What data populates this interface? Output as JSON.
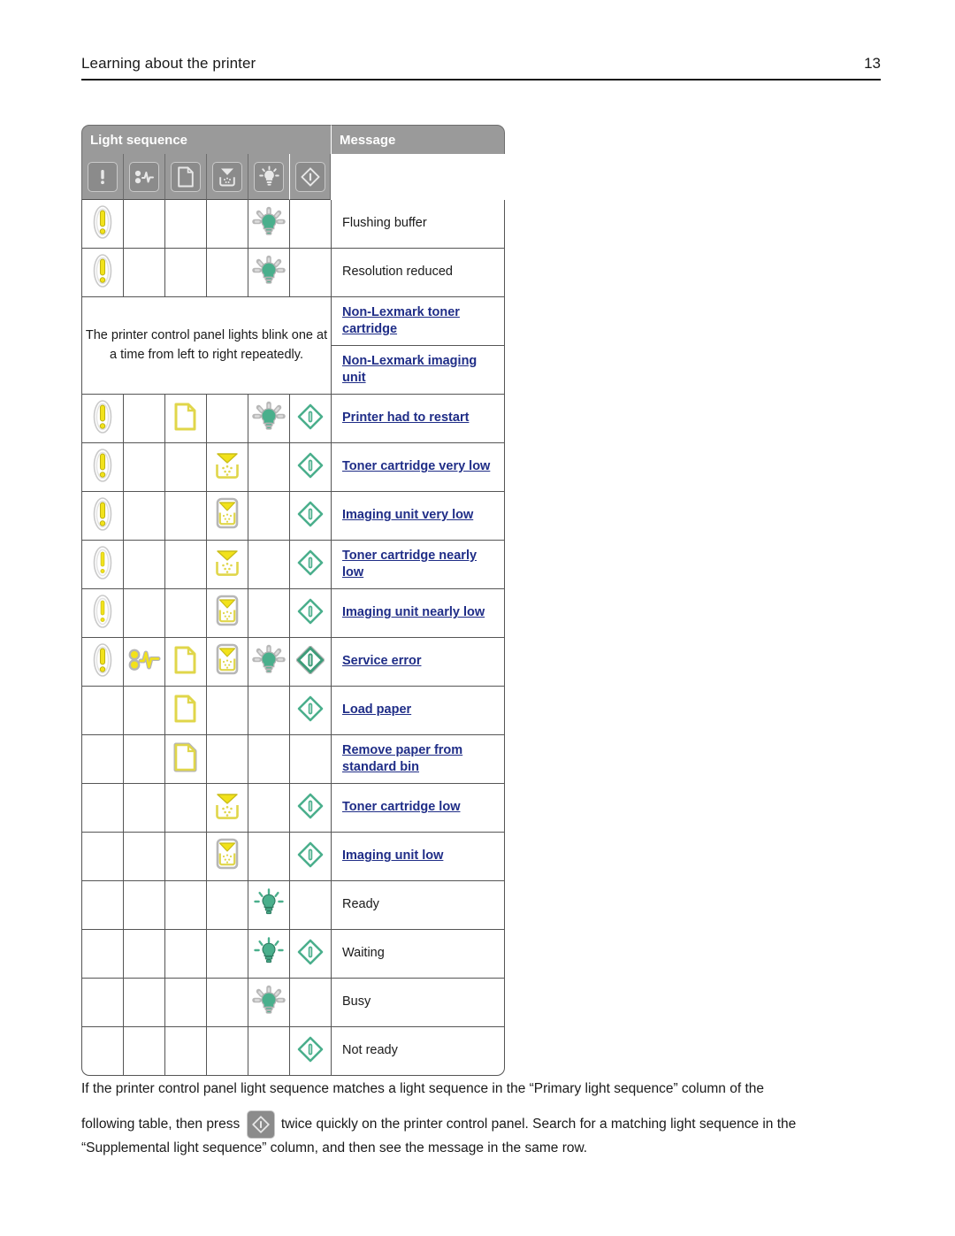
{
  "header": {
    "section_title": "Learning about the printer",
    "page_number": "13"
  },
  "table": {
    "col_header_lights": "Light sequence",
    "col_header_message": "Message",
    "legend_icons": [
      {
        "name": "error-icon",
        "label": "Error"
      },
      {
        "name": "paper-jam-icon",
        "label": "Paper jam"
      },
      {
        "name": "load-paper-icon",
        "label": "Load paper"
      },
      {
        "name": "toner-low-icon",
        "label": "Toner low"
      },
      {
        "name": "ready-icon",
        "label": "Ready"
      },
      {
        "name": "start-icon",
        "label": "Start"
      }
    ],
    "blink_note": "The printer control panel lights blink one at a time from left to right repeatedly.",
    "rows": [
      {
        "lights": [
          "error-blink",
          "",
          "",
          "",
          "ready-blink",
          ""
        ],
        "message": "Flushing buffer",
        "link": false
      },
      {
        "lights": [
          "error-blink",
          "",
          "",
          "",
          "ready-blink",
          ""
        ],
        "message": "Resolution reduced",
        "link": false
      },
      {
        "lights": [
          "error-blink",
          "",
          "paper-on",
          "",
          "ready-blink",
          "start-on"
        ],
        "message": "Printer had to restart",
        "link": true
      },
      {
        "lights": [
          "error-blink",
          "",
          "",
          "toner-on",
          "",
          "start-on"
        ],
        "message": "Toner cartridge very low",
        "link": true
      },
      {
        "lights": [
          "error-blink",
          "",
          "",
          "imaging-on",
          "",
          "start-on"
        ],
        "message": "Imaging unit very low",
        "link": true
      },
      {
        "lights": [
          "error-dim",
          "",
          "",
          "toner-on",
          "",
          "start-on"
        ],
        "message": "Toner cartridge nearly low",
        "link": true
      },
      {
        "lights": [
          "error-dim",
          "",
          "",
          "imaging-blink",
          "",
          "start-on"
        ],
        "message": "Imaging unit nearly low",
        "link": true
      },
      {
        "lights": [
          "error-blink",
          "jam-on",
          "paper-on",
          "imaging-blink",
          "ready-blink",
          "start-blink"
        ],
        "message": "Service error",
        "link": true
      },
      {
        "lights": [
          "",
          "",
          "paper-on",
          "",
          "",
          "start-on"
        ],
        "message": "Load paper",
        "link": true
      },
      {
        "lights": [
          "",
          "",
          "paper-blink",
          "",
          "",
          ""
        ],
        "message": "Remove paper from standard bin",
        "link": true
      },
      {
        "lights": [
          "",
          "",
          "",
          "toner-on",
          "",
          "start-on"
        ],
        "message": "Toner cartridge low",
        "link": true
      },
      {
        "lights": [
          "",
          "",
          "",
          "imaging-blink",
          "",
          "start-on"
        ],
        "message": "Imaging unit low",
        "link": true
      },
      {
        "lights": [
          "",
          "",
          "",
          "",
          "ready-on",
          ""
        ],
        "message": "Ready",
        "link": false
      },
      {
        "lights": [
          "",
          "",
          "",
          "",
          "ready-on",
          "start-on"
        ],
        "message": "Waiting",
        "link": false
      },
      {
        "lights": [
          "",
          "",
          "",
          "",
          "ready-blink",
          ""
        ],
        "message": "Busy",
        "link": false
      },
      {
        "lights": [
          "",
          "",
          "",
          "",
          "",
          "start-on"
        ],
        "message": "Not ready",
        "link": false
      }
    ],
    "non_lexmark_rows": [
      {
        "message": "Non-Lexmark toner cartridge",
        "link": true
      },
      {
        "message": "Non-Lexmark imaging unit",
        "link": true
      }
    ]
  },
  "footnote": {
    "part1": "If the printer control panel light sequence matches a light sequence in the “Primary light sequence” column of the",
    "part2": "following table, then press",
    "part3": "twice quickly on the printer control panel. Search for a matching light sequence in the “Supplemental light sequence” column, and then see the message in the same row.",
    "inline_icon": "start-icon"
  },
  "colors": {
    "header_band": "#9a9a9a",
    "link": "#1f2d87",
    "light_yellow": "#f2e21a",
    "light_green": "#4aaf8c",
    "grid": "#555555"
  }
}
